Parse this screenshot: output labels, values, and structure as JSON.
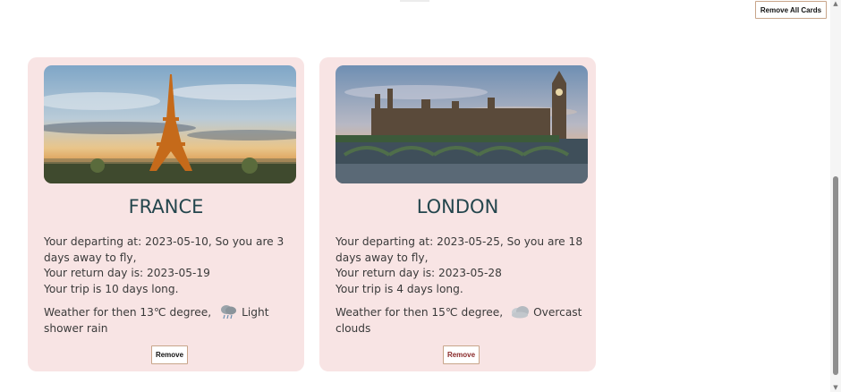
{
  "toolbar": {
    "remove_all_label": "Remove All Cards"
  },
  "cards": [
    {
      "title": "FRANCE",
      "image_icon": "eiffel-tower-photo",
      "departing": "Your departing at: 2023-05-10, So you are 3 days away to fly,",
      "return_day": "Your return day is: 2023-05-19",
      "trip_length": "Your trip is 10 days long.",
      "weather_prefix": "Weather for then 13℃ degree,",
      "weather_icon": "rain-cloud-icon",
      "weather_desc": "Light shower rain",
      "remove_label": "Remove"
    },
    {
      "title": "LONDON",
      "image_icon": "westminster-photo",
      "departing": "Your departing at: 2023-05-25, So you are 18 days away to fly,",
      "return_day": "Your return day is: 2023-05-28",
      "trip_length": "Your trip is 4 days long.",
      "weather_prefix": "Weather for then 15℃ degree,",
      "weather_icon": "overcast-cloud-icon",
      "weather_desc": "Overcast clouds",
      "remove_label": "Remove"
    }
  ],
  "colors": {
    "card_bg": "#f8e4e4",
    "title": "#24464d",
    "button_border": "#c8a58a",
    "london_remove_text": "#8a2a2a"
  }
}
